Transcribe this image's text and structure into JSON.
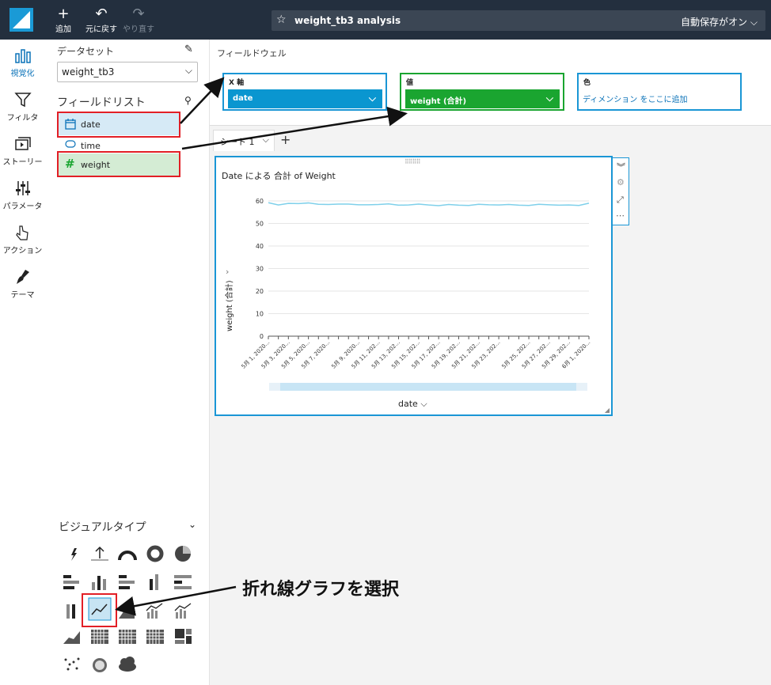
{
  "topbar": {
    "add_label": "追加",
    "undo_label": "元に戻す",
    "redo_label": "やり直す",
    "analysis_title": "weight_tb3 analysis",
    "autosave_label": "自動保存がオン"
  },
  "leftnav": {
    "items": [
      {
        "label": "視覚化",
        "icon": "bar-chart-icon"
      },
      {
        "label": "フィルタ",
        "icon": "filter-icon"
      },
      {
        "label": "ストーリー",
        "icon": "story-icon"
      },
      {
        "label": "パラメータ",
        "icon": "sliders-icon"
      },
      {
        "label": "アクション",
        "icon": "pointer-icon"
      },
      {
        "label": "テーマ",
        "icon": "brush-icon"
      }
    ]
  },
  "fields": {
    "dataset_label": "データセット",
    "dataset_value": "weight_tb3",
    "field_list_label": "フィールドリスト",
    "items": [
      {
        "name": "date",
        "type": "date"
      },
      {
        "name": "time",
        "type": "string"
      },
      {
        "name": "weight",
        "type": "number"
      }
    ],
    "visual_types_label": "ビジュアルタイプ"
  },
  "wells": {
    "header": "フィールドウェル",
    "x_axis": {
      "label": "X 軸",
      "value": "date",
      "color": "#0a96d0"
    },
    "value": {
      "label": "値",
      "value": "weight (合計)",
      "color": "#1aa530"
    },
    "color": {
      "label": "色",
      "placeholder": "ディメンション をここに追加"
    }
  },
  "sheet": {
    "tab_label": "シート 1"
  },
  "chart_data": {
    "type": "line",
    "title": "Date による 合計 of Weight",
    "xlabel": "date",
    "ylabel": "weight (合計)",
    "ylim": [
      0,
      60
    ],
    "yticks": [
      0,
      10,
      20,
      30,
      40,
      50,
      60
    ],
    "x_tick_labels": [
      "5月 1, 2020...",
      "5月 3, 2020...",
      "5月 5, 2020...",
      "5月 7, 2020...",
      "5月 9, 2020...",
      "5月 11, 202...",
      "5月 13, 202...",
      "5月 15, 202...",
      "5月 17, 202...",
      "5月 19, 202...",
      "5月 21, 202...",
      "5月 23, 202...",
      "5月 25, 202...",
      "5月 27, 202...",
      "5月 29, 202...",
      "6月 1, 2020..."
    ],
    "series": [
      {
        "color": "#7fd0ea",
        "values": [
          59.2,
          58.2,
          58.9,
          58.8,
          59.1,
          58.5,
          58.4,
          58.6,
          58.6,
          58.3,
          58.3,
          58.4,
          58.7,
          58.1,
          58.2,
          58.6,
          58.2,
          57.9,
          58.4,
          58.1,
          58.0,
          58.5,
          58.3,
          58.2,
          58.4,
          58.1,
          58.0,
          58.5,
          58.3,
          58.1,
          58.2,
          58.0,
          59.0
        ]
      }
    ]
  },
  "annotation": {
    "callout_text": "折れ線グラフを選択"
  }
}
